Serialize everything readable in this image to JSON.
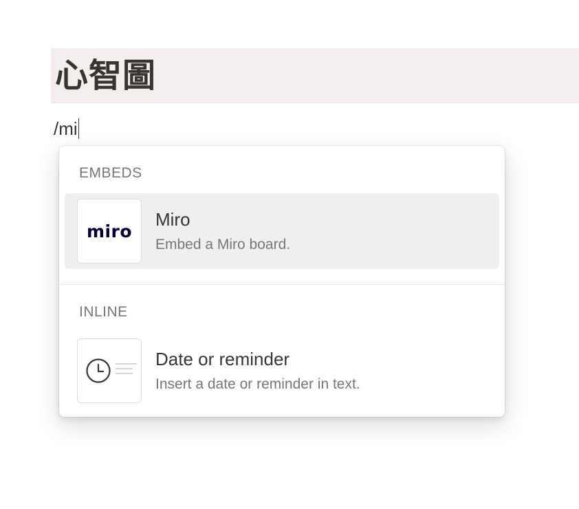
{
  "page": {
    "title": "心智圖",
    "command_text": "/mi"
  },
  "menu": {
    "sections": [
      {
        "label": "EMBEDS",
        "items": [
          {
            "logo": "miro",
            "title": "Miro",
            "description": "Embed a Miro board.",
            "selected": true
          }
        ]
      },
      {
        "label": "INLINE",
        "items": [
          {
            "icon": "clock-icon",
            "title": "Date or reminder",
            "description": "Insert a date or reminder in text.",
            "selected": false
          }
        ]
      }
    ]
  },
  "colors": {
    "title_background": "#f4eeee",
    "selected_background": "#efefef",
    "text_primary": "#37352f",
    "text_secondary": "#787774"
  }
}
